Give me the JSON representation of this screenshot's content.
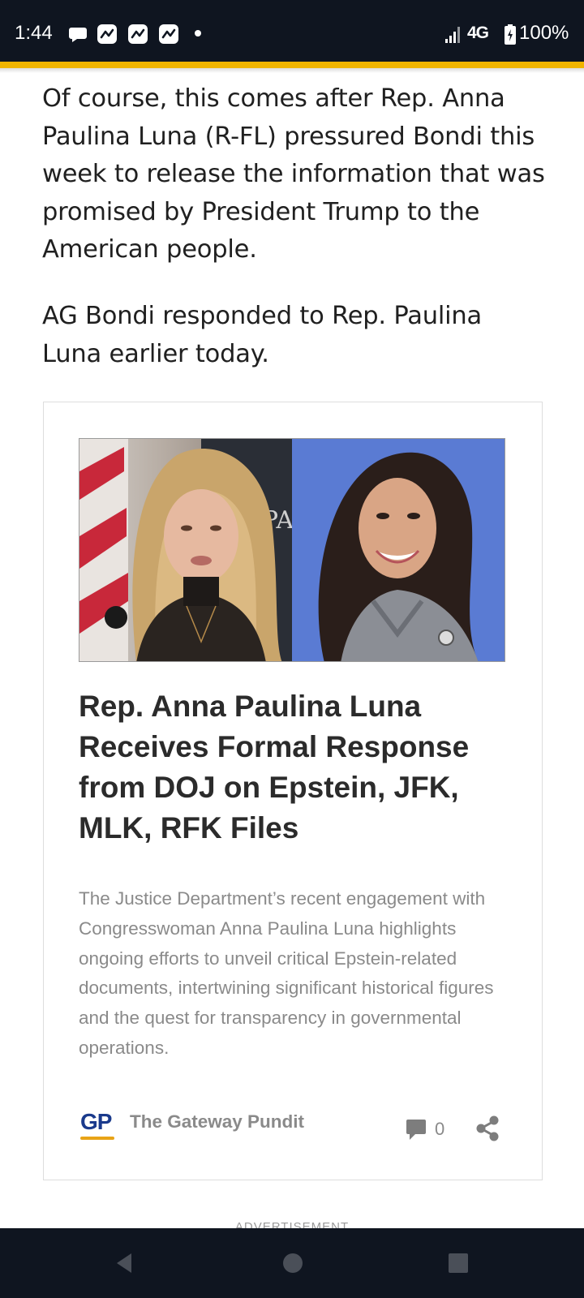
{
  "status_bar": {
    "time": "1:44",
    "network": "4G",
    "battery": "100%"
  },
  "article": {
    "paragraphs": [
      "Of course, this comes after Rep. Anna Paulina Luna (R-FL) pressured Bondi this week to release the information that was promised by President Trump to the American people.",
      "AG Bondi responded to Rep. Paulina Luna earlier today."
    ]
  },
  "card": {
    "image_sign_text": "EPA",
    "headline": "Rep. Anna Paulina Luna Receives Formal Response from DOJ on Epstein, JFK, MLK, RFK Files",
    "summary": "The Justice Department’s recent engagement with Congresswoman Anna Paulina Luna highlights ongoing efforts to unveil critical Epstein-related documents, intertwining significant historical figures and the quest for transparency in governmental operations.",
    "source_logo": "GP",
    "source_name": "The Gateway Pundit",
    "comment_count": "0"
  },
  "advertisement_label": "ADVERTISEMENT",
  "colors": {
    "status_bar_bg": "#0f1520",
    "accent": "#f0b400",
    "logo_blue": "#1a3a8c",
    "muted_text": "#8a8a8a"
  },
  "icons": {
    "notifications": [
      "chat-bubble-icon",
      "trend-app-icon",
      "trend-app-icon",
      "trend-app-icon",
      "more-dot-icon"
    ],
    "status": [
      "signal-icon",
      "battery-charging-icon"
    ],
    "card": [
      "comment-icon",
      "share-icon"
    ],
    "nav": [
      "back-icon",
      "home-icon",
      "recents-icon"
    ]
  }
}
